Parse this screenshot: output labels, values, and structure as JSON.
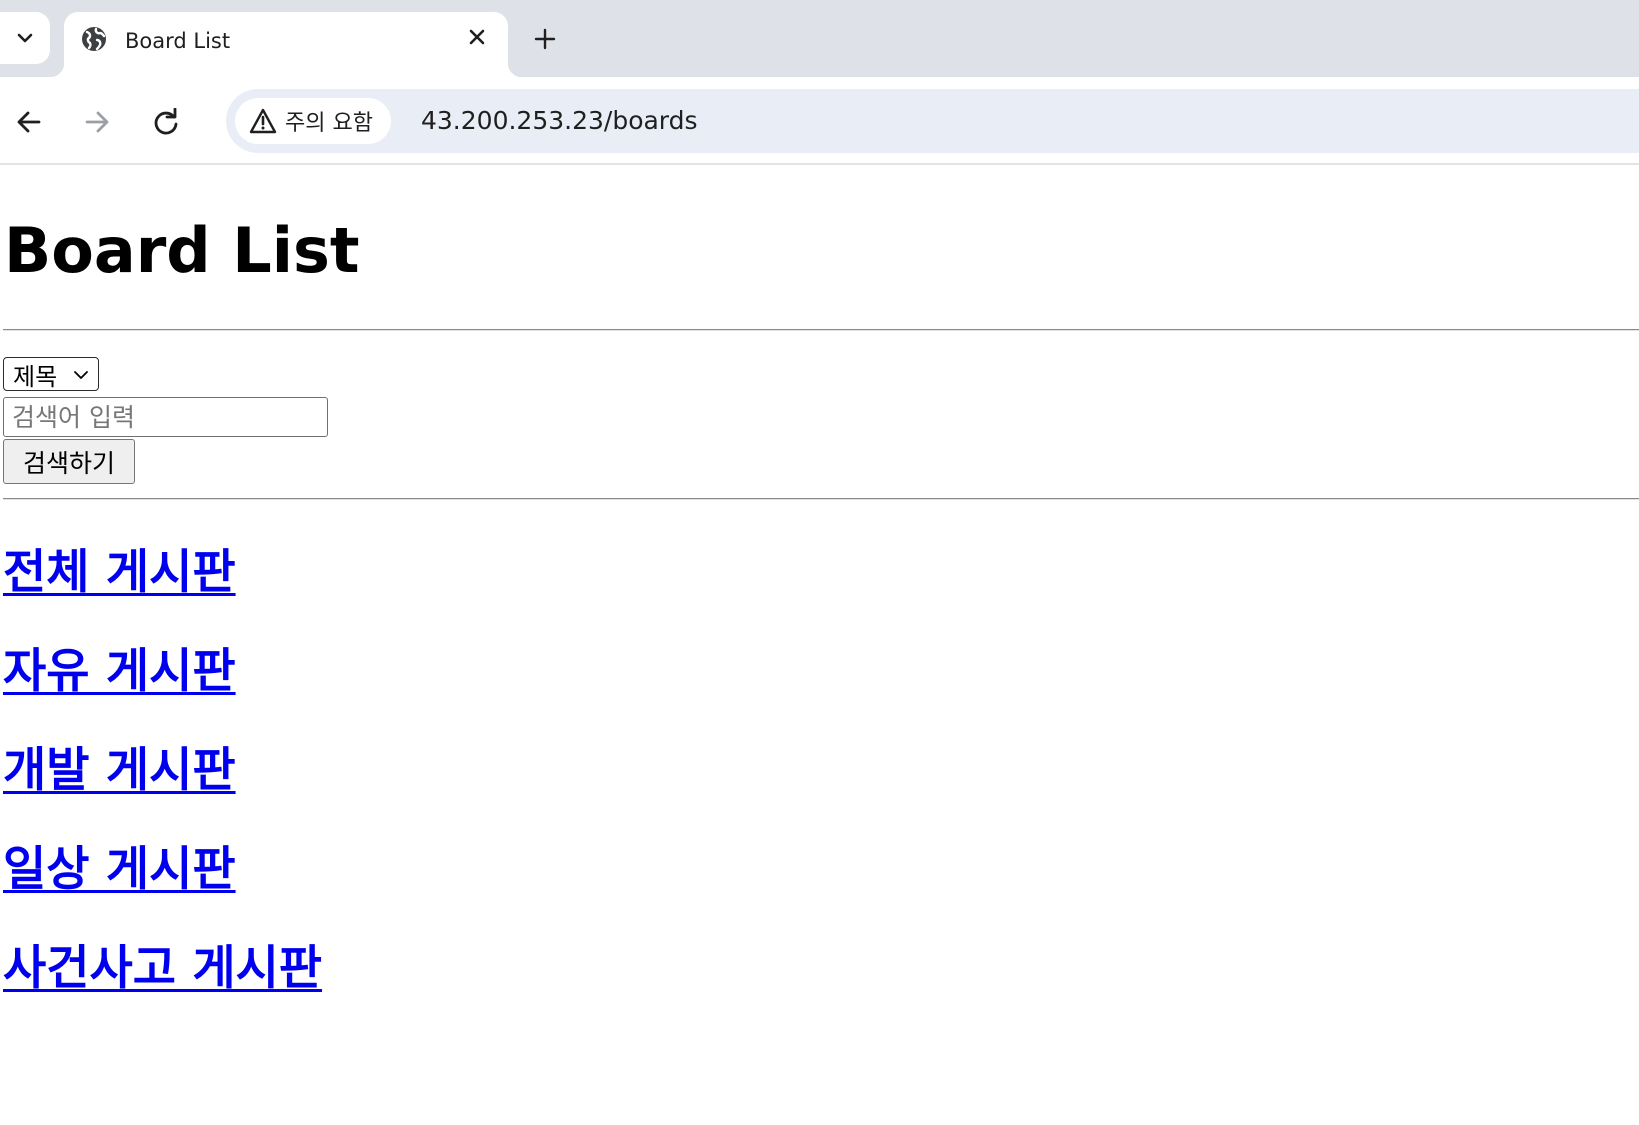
{
  "browser": {
    "tab": {
      "title": "Board List",
      "favicon_icon": "globe-icon",
      "close_icon": "close-icon"
    },
    "tab_search_icon": "chevron-down-icon",
    "new_tab_icon": "plus-icon",
    "nav": {
      "back_icon": "arrow-left-icon",
      "forward_icon": "arrow-right-icon",
      "reload_icon": "reload-icon"
    },
    "address_bar": {
      "security_icon": "warning-triangle-icon",
      "security_label": "주의 요함",
      "url": "43.200.253.23/boards"
    }
  },
  "page": {
    "title": "Board List",
    "search": {
      "select_value": "제목",
      "input_placeholder": "검색어 입력",
      "input_value": "",
      "button_label": "검색하기"
    },
    "boards": [
      {
        "label": "전체 게시판"
      },
      {
        "label": "자유 게시판"
      },
      {
        "label": "개발 게시판"
      },
      {
        "label": "일상 게시판"
      },
      {
        "label": "사건사고 게시판"
      }
    ]
  },
  "colors": {
    "link": "#0000ee",
    "tabstrip_bg": "#dee2e8",
    "omnibox_bg": "#e9eef6"
  }
}
